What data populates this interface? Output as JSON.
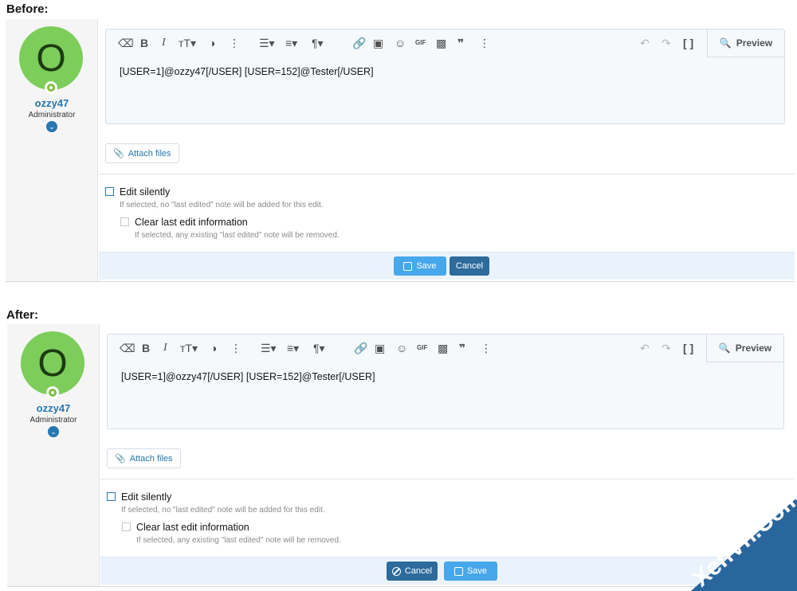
{
  "before_label": "Before:",
  "after_label": "After:",
  "user": {
    "avatar_letter": "O",
    "name": "ozzy47",
    "title": "Administrator"
  },
  "toolbar": {
    "gif_label": "GIF",
    "preview_label": "Preview"
  },
  "editor": {
    "content": "[USER=1]@ozzy47[/USER] [USER=152]@Tester[/USER]"
  },
  "attach_label": "Attach files",
  "options": {
    "edit_silently_label": "Edit silently",
    "edit_silently_hint": "If selected, no \"last edited\" note will be added for this edit.",
    "clear_edit_label": "Clear last edit information",
    "clear_edit_hint": "If selected, any existing \"last edited\" note will be removed."
  },
  "buttons": {
    "save_label": "Save",
    "cancel_label": "Cancel"
  },
  "watermark": {
    "text": "XenVn.Com"
  }
}
